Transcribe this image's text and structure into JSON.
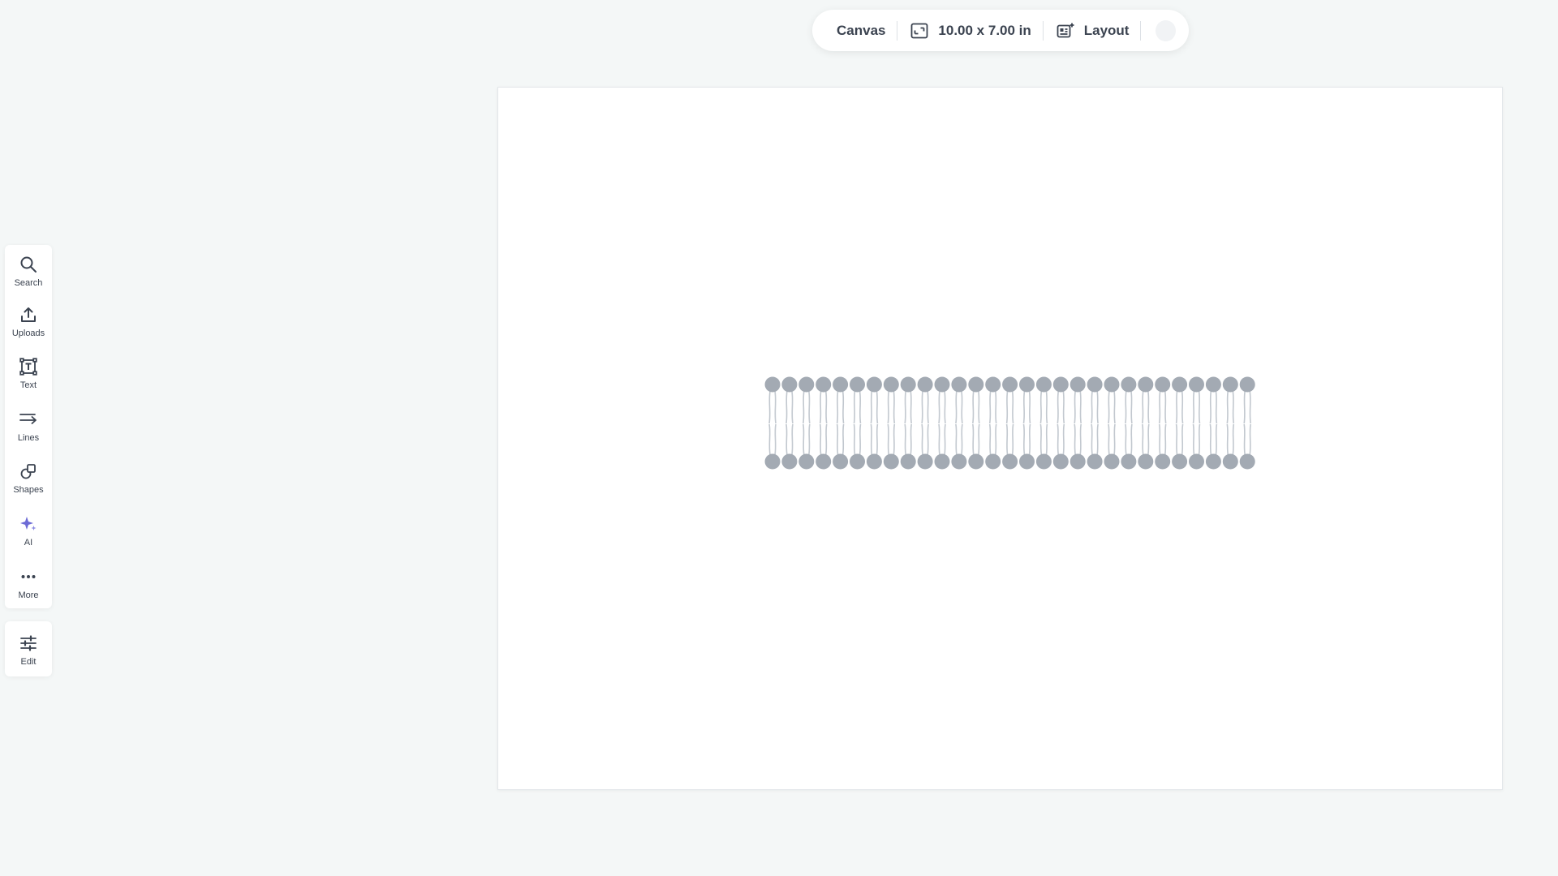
{
  "toolbar": {
    "canvas_label": "Canvas",
    "size_label": "10.00 x 7.00 in",
    "layout_label": "Layout",
    "icons": {
      "resize": "resize-icon",
      "layout": "layout-icon"
    }
  },
  "rail": {
    "items": [
      {
        "label": "Search",
        "icon": "search-icon"
      },
      {
        "label": "Uploads",
        "icon": "upload-icon"
      },
      {
        "label": "Text",
        "icon": "text-icon"
      },
      {
        "label": "Lines",
        "icon": "lines-icon"
      },
      {
        "label": "Shapes",
        "icon": "shapes-icon"
      },
      {
        "label": "AI",
        "icon": "ai-sparkle-icon"
      },
      {
        "label": "More",
        "icon": "more-icon"
      }
    ],
    "edit": {
      "label": "Edit",
      "icon": "sliders-icon"
    }
  },
  "canvas": {
    "element": "lipid-bilayer-graphic",
    "lipid_count_per_row": 29,
    "head_color": "#a3aab3",
    "tail_color": "#c2c8cf"
  },
  "colors": {
    "background": "#f4f7f7",
    "text": "#3b4350",
    "ai_accent": "#6d6bd6"
  }
}
